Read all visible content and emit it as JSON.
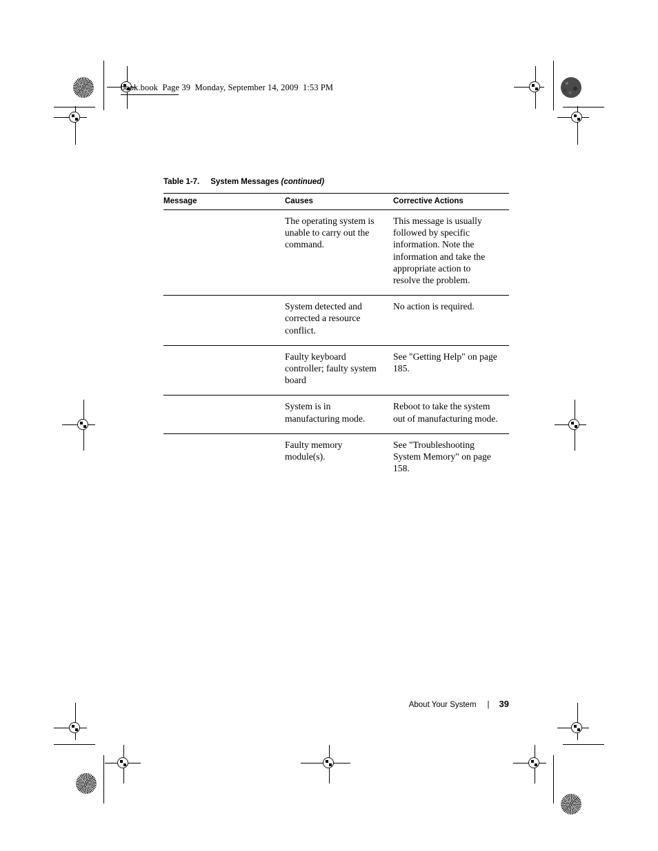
{
  "running_head": "book.book  Page 39  Monday, September 14, 2009  1:53 PM",
  "table": {
    "caption_number": "Table 1-7.",
    "caption_title": "System Messages",
    "caption_continued": "(continued)",
    "headers": [
      "Message",
      "Causes",
      "Corrective Actions"
    ],
    "rows": [
      {
        "message": "",
        "causes": "The operating system is unable to carry out the command.",
        "corrective": "This message is usually followed by specific information. Note the information and take the appropriate action to resolve the problem."
      },
      {
        "message": "",
        "causes": "System detected and corrected a resource conflict.",
        "corrective": "No action is required."
      },
      {
        "message": "",
        "causes": "Faulty keyboard controller; faulty system board",
        "corrective": "See \"Getting Help\" on page 185."
      },
      {
        "message": "",
        "causes": "System is in manufacturing mode.",
        "corrective": "Reboot to take the system out of manufacturing mode."
      },
      {
        "message": "",
        "causes": "Faulty memory module(s).",
        "corrective": "See \"Troubleshooting System Memory\" on page 158."
      }
    ]
  },
  "footer": {
    "section": "About Your System",
    "separator": "|",
    "page_number": "39"
  }
}
